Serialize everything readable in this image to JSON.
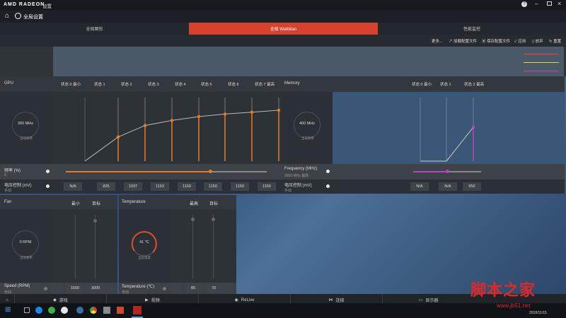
{
  "app": {
    "brand": "AMD RADEON",
    "title_suffix": "设置",
    "window_title": "全局设置"
  },
  "tabs": [
    {
      "label": "全局图形"
    },
    {
      "label": "全局 WattMan"
    },
    {
      "label": "性能监控"
    }
  ],
  "toolbar": {
    "more": "更多...",
    "load_profile": "加载配置文件",
    "save_profile": "保存配置文件",
    "apply": "应用",
    "discard": "放弃",
    "reset": "重置"
  },
  "gpu": {
    "title": "GPU",
    "states": [
      "状态 0 最小",
      "状态 1",
      "状态 2",
      "状态 3",
      "状态 4",
      "状态 5",
      "状态 6",
      "状态 7 最高"
    ],
    "gauge_value": "300 MHz",
    "gauge_label": "当前频率",
    "frequency_label": "频率 (%)",
    "frequency_value": "0",
    "voltage_label": "电压控制 (mV)",
    "voltage_mode": "手动",
    "voltages": [
      "N/A",
      "825",
      "1037",
      "1193",
      "1150",
      "1150",
      "1150",
      "1150"
    ],
    "curve_levels": [
      0.0,
      0.38,
      0.56,
      0.64,
      0.7,
      0.74,
      0.77,
      0.8
    ],
    "slider_level": 0.72,
    "accent": "#f07a1a"
  },
  "memory": {
    "title": "Memory",
    "states": [
      "状态 0 最小",
      "状态 1",
      "状态 2 最高"
    ],
    "gauge_value": "400 MHz",
    "gauge_label": "当前频率",
    "frequency_label": "Frequency (MHz)",
    "frequency_value": "2000 MHz 最高",
    "voltage_label": "电压控制 (mV)",
    "voltage_mode": "手动",
    "voltages": [
      "N/A",
      "N/A",
      "950"
    ],
    "slider_level": 0.5,
    "accent": "#c040c0"
  },
  "fan": {
    "title": "Fan",
    "col_min": "最小",
    "col_target": "目标",
    "gauge_value": "0 RPM",
    "gauge_label": "当前频率",
    "speed_label": "Speed (RPM)",
    "speed_mode": "自动",
    "min_value": "1600",
    "target_value": "3000"
  },
  "temperature": {
    "title": "Temperature",
    "col_max": "最高",
    "col_target": "目标",
    "gauge_value": "41 ℃",
    "gauge_label": "当前温度",
    "temp_label": "Temperature (℃)",
    "temp_mode": "自动",
    "max_value": "85",
    "target_value": "70",
    "accent": "#e04a30"
  },
  "navbar": [
    {
      "label": "游戏",
      "icon": "gamepad-icon"
    },
    {
      "label": "视频",
      "icon": "film-icon"
    },
    {
      "label": "ReLive",
      "icon": "relive-icon"
    },
    {
      "label": "连接",
      "icon": "share-icon"
    },
    {
      "label": "显示器",
      "icon": "monitor-icon"
    }
  ],
  "taskbar": {
    "date": "2018/11/15"
  },
  "watermark": {
    "text_cn": "脚本之家",
    "url": "www.jb51.net"
  },
  "legend_colors": [
    "#e04a30",
    "#d8d840",
    "#c040c0"
  ]
}
